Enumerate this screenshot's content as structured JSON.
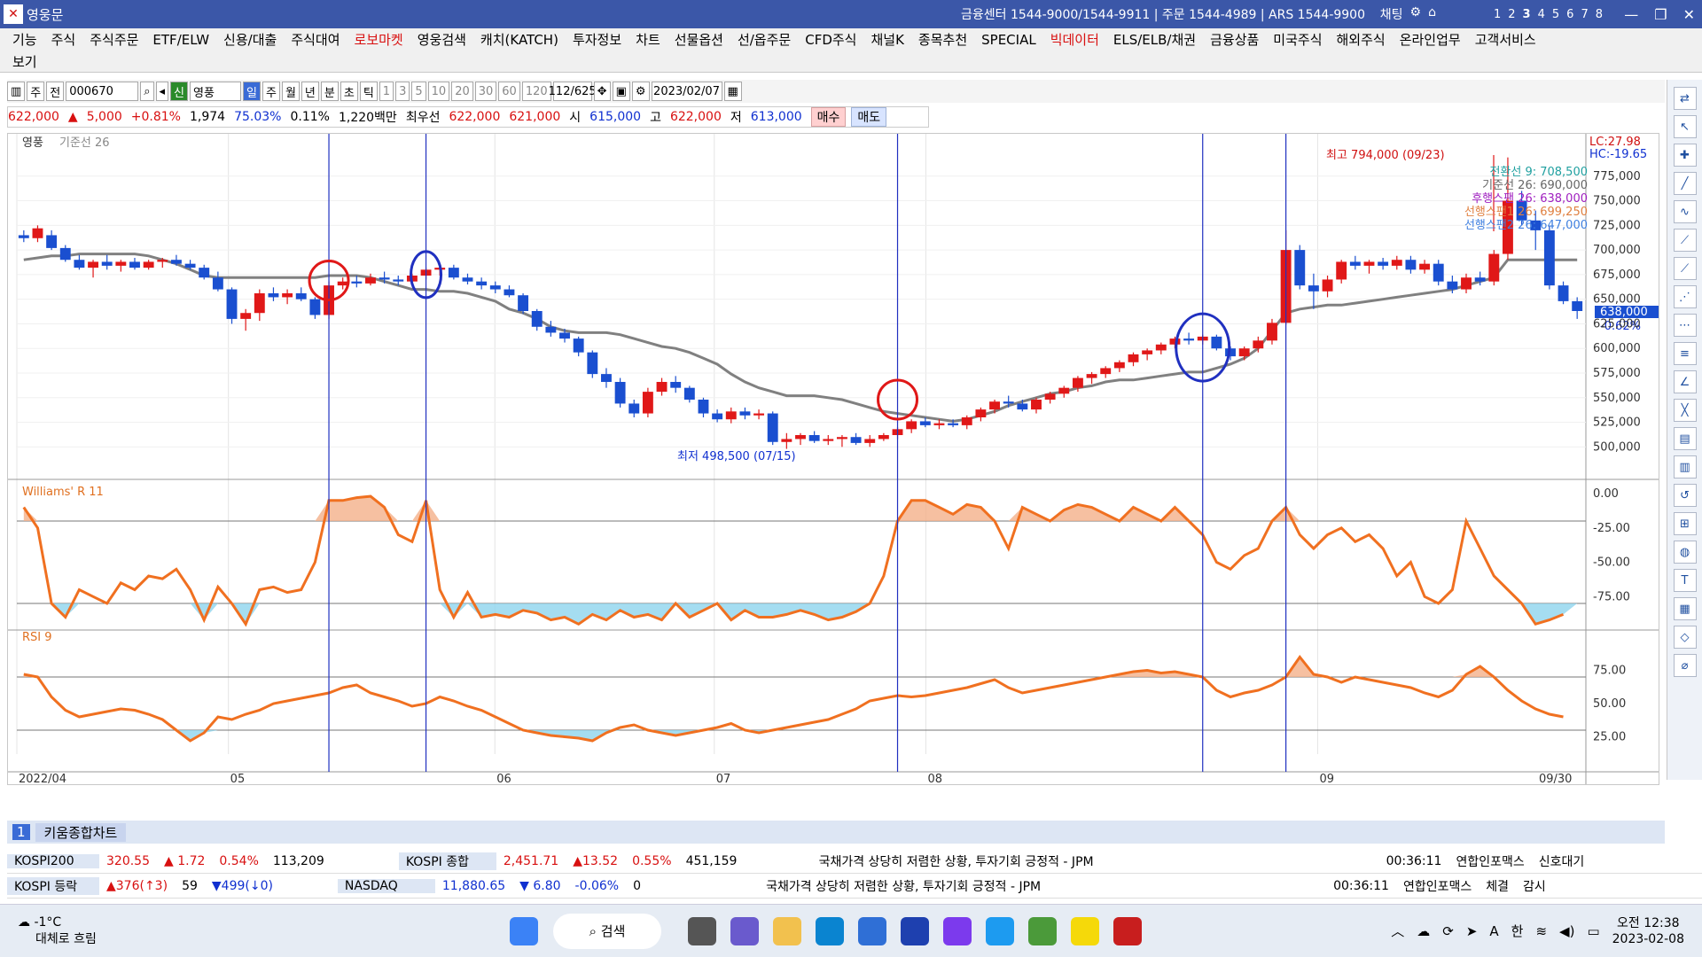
{
  "window": {
    "title": "영웅문",
    "info": "금융센터 1544-9000/1544-9911 | 주문 1544-4989 | ARS 1544-9900",
    "chat": "채팅",
    "nums": [
      "1",
      "2",
      "3",
      "4",
      "5",
      "6",
      "7",
      "8"
    ]
  },
  "menu": {
    "row1": [
      "기능",
      "주식",
      "주식주문",
      "ETF/ELW",
      "신용/대출",
      "주식대여",
      "로보마켓",
      "영웅검색",
      "캐치(KATCH)",
      "투자정보",
      "차트",
      "선물옵션",
      "선/옵주문",
      "CFD주식",
      "채널K",
      "종목추천",
      "SPECIAL",
      "빅데이터",
      "ELS/ELB/채권",
      "금융상품",
      "미국주식",
      "해외주식",
      "온라인업무",
      "고객서비스"
    ],
    "row1_red": [
      "로보마켓",
      "빅데이터"
    ],
    "row2": [
      "보기"
    ]
  },
  "toolbar": {
    "period_chars": [
      "주",
      "전"
    ],
    "code": "000670",
    "name": "영풍",
    "credit": "신",
    "intervals": [
      "일",
      "주",
      "월",
      "년",
      "분",
      "초",
      "틱"
    ],
    "minutes": [
      "1",
      "3",
      "5",
      "10",
      "20",
      "30",
      "60",
      "120"
    ],
    "count": "112/625",
    "date": "2023/02/07"
  },
  "quote": {
    "price": "622,000",
    "change": "5,000",
    "pct": "+0.81%",
    "volume": "1,974",
    "ratio": "75.03%",
    "turnover": "0.11%",
    "amount": "1,220백만",
    "best_label": "최우선",
    "best_ask": "622,000",
    "best_bid": "621,000",
    "open_label": "시",
    "open": "615,000",
    "high_label": "고",
    "high": "622,000",
    "low_label": "저",
    "low": "613,000",
    "buy": "매수",
    "sell": "매도"
  },
  "chart": {
    "pane1_title": "영풍",
    "pane1_indicator": "기준선 26",
    "high_label": "최고 794,000 (09/23)",
    "low_label": "최저 498,500 (07/15)",
    "legend": [
      "전환선 9: 708,500",
      "기준선 26: 690,000",
      "후행스팬 26: 638,000",
      "선행스팬1 26: 699,250",
      "선행스팬2 26: 647,000"
    ],
    "lc": "LC:27.98",
    "hc": "HC:-19.65",
    "current": "638,000",
    "current_pct": "-0.62%",
    "pane2_title": "Williams' R 11",
    "pane3_title": "RSI 9",
    "x_labels": [
      "2022/04",
      "05",
      "06",
      "07",
      "08",
      "09",
      "09/30"
    ],
    "main_ticks": [
      "775,000",
      "750,000",
      "725,000",
      "700,000",
      "675,000",
      "650,000",
      "625,000",
      "600,000",
      "575,000",
      "550,000",
      "525,000",
      "500,000"
    ],
    "wr_ticks": [
      "0.00",
      "-25.00",
      "-50.00",
      "-75.00"
    ],
    "rsi_ticks": [
      "75.00",
      "50.00",
      "25.00"
    ]
  },
  "chart_data": {
    "type": "candlestick",
    "ylim": [
      485000,
      800000
    ],
    "candles": [
      [
        715,
        720,
        708,
        712
      ],
      [
        712,
        725,
        708,
        722
      ],
      [
        715,
        720,
        700,
        702
      ],
      [
        702,
        705,
        688,
        690
      ],
      [
        690,
        695,
        680,
        682
      ],
      [
        682,
        690,
        672,
        688
      ],
      [
        688,
        695,
        680,
        684
      ],
      [
        684,
        690,
        678,
        688
      ],
      [
        688,
        692,
        680,
        682
      ],
      [
        682,
        690,
        680,
        688
      ],
      [
        688,
        692,
        682,
        690
      ],
      [
        690,
        695,
        684,
        686
      ],
      [
        686,
        690,
        680,
        682
      ],
      [
        682,
        685,
        670,
        672
      ],
      [
        672,
        678,
        658,
        660
      ],
      [
        660,
        662,
        625,
        630
      ],
      [
        630,
        640,
        618,
        636
      ],
      [
        636,
        660,
        628,
        656
      ],
      [
        656,
        662,
        648,
        652
      ],
      [
        652,
        660,
        645,
        656
      ],
      [
        656,
        662,
        648,
        650
      ],
      [
        650,
        652,
        630,
        634
      ],
      [
        634,
        668,
        630,
        664
      ],
      [
        664,
        672,
        660,
        668
      ],
      [
        668,
        674,
        662,
        666
      ],
      [
        666,
        676,
        664,
        672
      ],
      [
        672,
        678,
        666,
        670
      ],
      [
        670,
        674,
        664,
        668
      ],
      [
        668,
        676,
        664,
        674
      ],
      [
        674,
        682,
        670,
        680
      ],
      [
        680,
        684,
        674,
        682
      ],
      [
        682,
        685,
        670,
        672
      ],
      [
        672,
        676,
        665,
        668
      ],
      [
        668,
        672,
        660,
        664
      ],
      [
        664,
        668,
        656,
        660
      ],
      [
        660,
        664,
        652,
        654
      ],
      [
        654,
        656,
        635,
        638
      ],
      [
        638,
        640,
        618,
        622
      ],
      [
        622,
        628,
        612,
        616
      ],
      [
        616,
        620,
        606,
        610
      ],
      [
        610,
        612,
        592,
        596
      ],
      [
        596,
        598,
        570,
        574
      ],
      [
        574,
        580,
        560,
        566
      ],
      [
        566,
        570,
        540,
        544
      ],
      [
        544,
        548,
        530,
        534
      ],
      [
        534,
        560,
        530,
        556
      ],
      [
        556,
        570,
        552,
        566
      ],
      [
        566,
        572,
        555,
        560
      ],
      [
        560,
        562,
        545,
        548
      ],
      [
        548,
        550,
        530,
        534
      ],
      [
        534,
        538,
        525,
        528
      ],
      [
        528,
        540,
        524,
        536
      ],
      [
        536,
        540,
        528,
        532
      ],
      [
        532,
        538,
        528,
        534
      ],
      [
        534,
        536,
        502,
        505
      ],
      [
        505,
        514,
        498,
        508
      ],
      [
        508,
        514,
        502,
        512
      ],
      [
        512,
        516,
        504,
        506
      ],
      [
        506,
        512,
        502,
        508
      ],
      [
        508,
        512,
        500,
        510
      ],
      [
        510,
        514,
        502,
        504
      ],
      [
        504,
        512,
        500,
        508
      ],
      [
        508,
        514,
        506,
        512
      ],
      [
        512,
        520,
        508,
        518
      ],
      [
        518,
        528,
        514,
        526
      ],
      [
        526,
        530,
        520,
        522
      ],
      [
        522,
        528,
        518,
        524
      ],
      [
        524,
        528,
        520,
        522
      ],
      [
        522,
        532,
        518,
        530
      ],
      [
        530,
        540,
        526,
        538
      ],
      [
        538,
        548,
        534,
        546
      ],
      [
        546,
        552,
        540,
        544
      ],
      [
        544,
        548,
        536,
        538
      ],
      [
        538,
        550,
        534,
        548
      ],
      [
        548,
        556,
        544,
        554
      ],
      [
        554,
        562,
        550,
        560
      ],
      [
        560,
        572,
        556,
        570
      ],
      [
        570,
        576,
        564,
        574
      ],
      [
        574,
        582,
        570,
        580
      ],
      [
        580,
        588,
        576,
        586
      ],
      [
        586,
        596,
        582,
        594
      ],
      [
        594,
        600,
        588,
        598
      ],
      [
        598,
        606,
        594,
        604
      ],
      [
        604,
        612,
        600,
        610
      ],
      [
        610,
        616,
        604,
        608
      ],
      [
        608,
        614,
        604,
        612
      ],
      [
        612,
        614,
        598,
        600
      ],
      [
        600,
        602,
        588,
        592
      ],
      [
        592,
        602,
        588,
        600
      ],
      [
        600,
        612,
        596,
        608
      ],
      [
        608,
        630,
        604,
        626
      ],
      [
        626,
        720,
        624,
        700
      ],
      [
        700,
        705,
        660,
        664
      ],
      [
        664,
        676,
        640,
        658
      ],
      [
        658,
        674,
        652,
        670
      ],
      [
        670,
        690,
        666,
        688
      ],
      [
        688,
        694,
        680,
        684
      ],
      [
        684,
        690,
        676,
        688
      ],
      [
        688,
        692,
        680,
        684
      ],
      [
        684,
        694,
        680,
        690
      ],
      [
        690,
        694,
        676,
        680
      ],
      [
        680,
        690,
        676,
        686
      ],
      [
        686,
        690,
        664,
        668
      ],
      [
        668,
        674,
        656,
        660
      ],
      [
        660,
        676,
        656,
        672
      ],
      [
        672,
        678,
        664,
        668
      ],
      [
        668,
        700,
        664,
        696
      ],
      [
        696,
        794,
        690,
        750
      ],
      [
        750,
        760,
        725,
        730
      ],
      [
        730,
        740,
        700,
        720
      ],
      [
        720,
        724,
        660,
        664
      ],
      [
        664,
        668,
        645,
        648
      ],
      [
        648,
        652,
        630,
        638
      ]
    ],
    "kijun": [
      690,
      692,
      694,
      694,
      696,
      696,
      696,
      696,
      696,
      694,
      690,
      686,
      680,
      674,
      672,
      672,
      672,
      672,
      672,
      672,
      672,
      672,
      674,
      674,
      674,
      672,
      668,
      664,
      660,
      660,
      658,
      658,
      656,
      652,
      648,
      640,
      636,
      630,
      622,
      618,
      616,
      616,
      616,
      614,
      610,
      606,
      602,
      600,
      596,
      590,
      584,
      574,
      566,
      560,
      556,
      552,
      552,
      552,
      550,
      548,
      544,
      540,
      536,
      534,
      532,
      530,
      528,
      526,
      528,
      532,
      536,
      542,
      546,
      550,
      554,
      556,
      560,
      562,
      566,
      568,
      568,
      570,
      572,
      574,
      576,
      576,
      580,
      584,
      590,
      600,
      618,
      636,
      640,
      642,
      644,
      644,
      646,
      648,
      650,
      652,
      654,
      656,
      658,
      660,
      664,
      668,
      672,
      690,
      690,
      690,
      690,
      690,
      690
    ],
    "williams_r": [
      -10,
      -25,
      -80,
      -90,
      -70,
      -75,
      -80,
      -65,
      -70,
      -60,
      -62,
      -55,
      -70,
      -92,
      -68,
      -80,
      -95,
      -70,
      -68,
      -72,
      -70,
      -50,
      -5,
      -5,
      -3,
      -2,
      -10,
      -30,
      -35,
      -5,
      -70,
      -90,
      -72,
      -90,
      -88,
      -90,
      -85,
      -87,
      -92,
      -90,
      -95,
      -88,
      -92,
      -85,
      -90,
      -88,
      -92,
      -80,
      -90,
      -85,
      -80,
      -92,
      -85,
      -90,
      -90,
      -88,
      -85,
      -88,
      -92,
      -90,
      -86,
      -80,
      -60,
      -20,
      -5,
      -5,
      -10,
      -15,
      -8,
      -10,
      -20,
      -40,
      -10,
      -15,
      -20,
      -12,
      -8,
      -10,
      -15,
      -20,
      -10,
      -15,
      -20,
      -10,
      -20,
      -30,
      -50,
      -55,
      -45,
      -40,
      -20,
      -10,
      -30,
      -40,
      -30,
      -25,
      -35,
      -30,
      -40,
      -60,
      -50,
      -75,
      -80,
      -70,
      -20,
      -40,
      -60,
      -70,
      -80,
      -95,
      -92,
      -88
    ],
    "rsi": [
      72,
      70,
      55,
      45,
      40,
      42,
      44,
      46,
      45,
      42,
      38,
      30,
      22,
      28,
      40,
      38,
      42,
      45,
      50,
      52,
      54,
      56,
      58,
      62,
      64,
      58,
      55,
      52,
      48,
      50,
      55,
      52,
      48,
      45,
      40,
      35,
      30,
      28,
      26,
      25,
      24,
      22,
      28,
      32,
      34,
      30,
      28,
      26,
      28,
      30,
      32,
      35,
      30,
      28,
      30,
      32,
      34,
      36,
      38,
      42,
      46,
      52,
      54,
      56,
      55,
      56,
      58,
      60,
      62,
      65,
      68,
      62,
      58,
      60,
      62,
      64,
      66,
      68,
      70,
      72,
      74,
      75,
      73,
      74,
      72,
      70,
      60,
      55,
      58,
      60,
      64,
      70,
      85,
      72,
      70,
      66,
      70,
      68,
      66,
      64,
      62,
      58,
      55,
      60,
      72,
      78,
      70,
      60,
      52,
      46,
      42,
      40
    ]
  }
}
